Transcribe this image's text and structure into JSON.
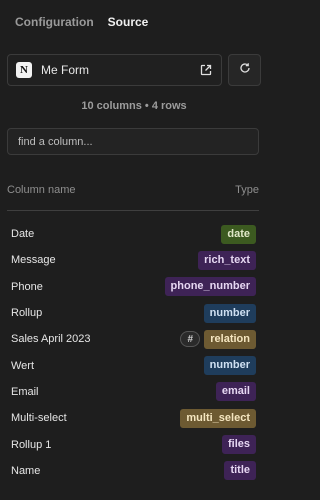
{
  "tabs": [
    {
      "label": "Configuration",
      "active": false
    },
    {
      "label": "Source",
      "active": true
    }
  ],
  "source": {
    "icon": "notion-icon",
    "icon_glyph": "N",
    "name": "Me Form",
    "open_icon": "external-link-icon",
    "refresh_icon": "refresh-icon"
  },
  "summary": "10 columns • 4 rows",
  "search": {
    "placeholder": "find a column...",
    "value": ""
  },
  "header": {
    "name": "Column name",
    "type": "Type"
  },
  "columns": [
    {
      "name": "Date",
      "type": "date"
    },
    {
      "name": "Message",
      "type": "rich_text"
    },
    {
      "name": "Phone",
      "type": "phone_number"
    },
    {
      "name": "Rollup",
      "type": "number"
    },
    {
      "name": "Sales April 2023",
      "type": "relation",
      "extra": "#"
    },
    {
      "name": "Wert",
      "type": "number"
    },
    {
      "name": "Email",
      "type": "email"
    },
    {
      "name": "Multi-select",
      "type": "multi_select"
    },
    {
      "name": "Rollup 1",
      "type": "files"
    },
    {
      "name": "Name",
      "type": "title"
    }
  ],
  "colors": {
    "background": "#1e1e1e",
    "purple_badge": "#3e2356",
    "green_badge": "#3c5a20",
    "blue_badge": "#1f3d5c",
    "gold_badge": "#6d5a32"
  }
}
